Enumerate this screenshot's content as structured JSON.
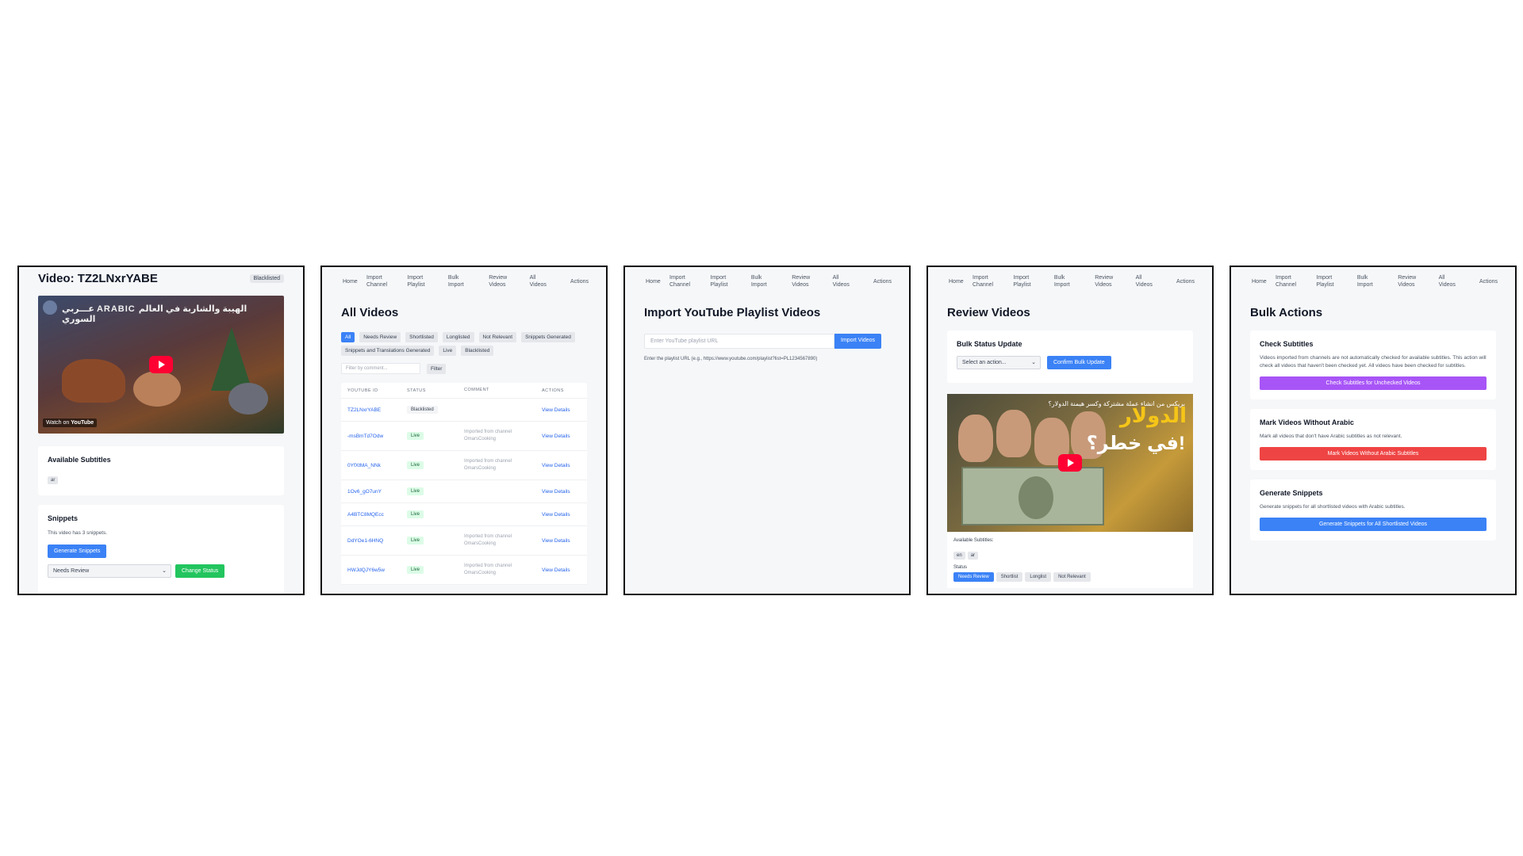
{
  "nav": {
    "items": [
      [
        "Home"
      ],
      [
        "Import",
        "Channel"
      ],
      [
        "Import",
        "Playlist"
      ],
      [
        "Bulk",
        "Import"
      ],
      [
        "Review",
        "Videos"
      ],
      [
        "All",
        "Videos"
      ],
      [
        "Actions"
      ]
    ]
  },
  "panel1": {
    "title": "Video: TZ2LNxrYABE",
    "badge": "Blacklisted",
    "video_title": "عـــربي ARABIC الهيبة والشاربة في العالم السوري",
    "watch_label": "Watch on",
    "yt_label": "YouTube",
    "subtitles_title": "Available Subtitles",
    "subtitle_chip": "ar",
    "snippets_title": "Snippets",
    "snippets_text": "This video has 3 snippets.",
    "generate_button": "Generate Snippets",
    "status_select": "Needs Review",
    "change_button": "Change Status"
  },
  "panel2": {
    "title": "All Videos",
    "filters": [
      "All",
      "Needs Review",
      "Shortlisted",
      "Longlisted",
      "Not Relevant",
      "Snippets Generated",
      "Snippets and Translations Generated",
      "Live",
      "Blacklisted"
    ],
    "filter_placeholder": "Filter by comment...",
    "filter_button": "Filter",
    "columns": [
      "YOUTUBE ID",
      "STATUS",
      "COMMENT",
      "ACTIONS"
    ],
    "rows": [
      {
        "id": "TZ2LNxrYABE",
        "status": "Blacklisted",
        "comment": "",
        "action": "View Details"
      },
      {
        "id": "-msBmTd7Odw",
        "status": "Live",
        "comment": "Imported from channel OmarsCooking",
        "action": "View Details"
      },
      {
        "id": "0YfXtMA_NNk",
        "status": "Live",
        "comment": "Imported from channel OmarsCooking",
        "action": "View Details"
      },
      {
        "id": "1Ov6_gO7unY",
        "status": "Live",
        "comment": "",
        "action": "View Details"
      },
      {
        "id": "A4BTC8MQEcc",
        "status": "Live",
        "comment": "",
        "action": "View Details"
      },
      {
        "id": "DdYOe1-6HNQ",
        "status": "Live",
        "comment": "Imported from channel OmarsCooking",
        "action": "View Details"
      },
      {
        "id": "HWJdQJY6w5w",
        "status": "Live",
        "comment": "Imported from channel OmarsCooking",
        "action": "View Details"
      }
    ]
  },
  "panel3": {
    "title": "Import YouTube Playlist Videos",
    "url_placeholder": "Enter YouTube playlist URL",
    "import_button": "Import Videos",
    "hint": "Enter the playlist URL (e.g., https://www.youtube.com/playlist?list=PL1234567890)"
  },
  "panel4": {
    "title": "Review Videos",
    "bulk_title": "Bulk Status Update",
    "select_label": "Select an action...",
    "confirm_button": "Confirm Bulk Update",
    "thumb_title": "بريكس من انشاء عملة مشتركة وكسر هيمنة الدولار؟",
    "thumb_line1": "الدولار",
    "thumb_line2": "في خطر؟!",
    "subtitles_label": "Available Subtitles:",
    "subtitle_chips": [
      "en",
      "ar"
    ],
    "status_label": "Status",
    "status_options": [
      "Needs Review",
      "Shortlist",
      "Longlist",
      "Not Relevant"
    ],
    "status_active": "Needs Review"
  },
  "panel5": {
    "title": "Bulk Actions",
    "cards": [
      {
        "title": "Check Subtitles",
        "text": "Videos imported from channels are not automatically checked for available subtitles. This action will check all videos that haven't been checked yet. All videos have been checked for subtitles.",
        "button": "Check Subtitles for Unchecked Videos",
        "color": "#a855f7"
      },
      {
        "title": "Mark Videos Without Arabic",
        "text": "Mark all videos that don't have Arabic subtitles as not relevant.",
        "button": "Mark Videos Without Arabic Subtitles",
        "color": "#ef4444"
      },
      {
        "title": "Generate Snippets",
        "text": "Generate snippets for all shortlisted videos with Arabic subtitles.",
        "button": "Generate Snippets for All Shortlisted Videos",
        "color": "#3b82f6"
      }
    ]
  }
}
